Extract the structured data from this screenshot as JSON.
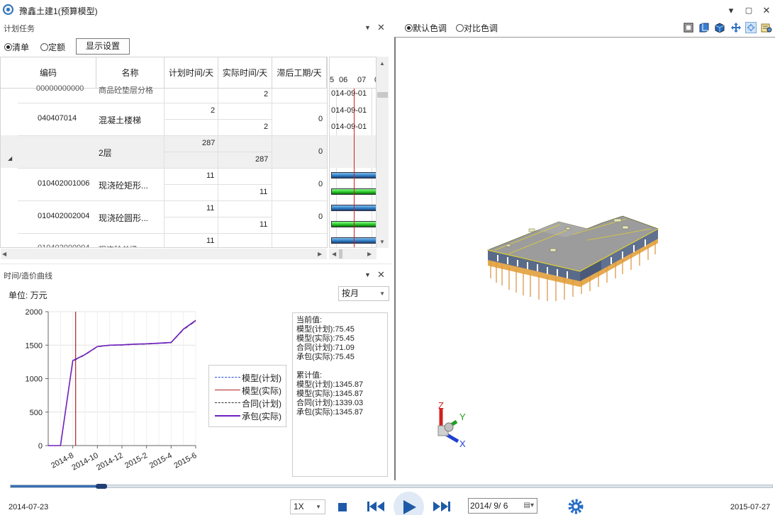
{
  "window": {
    "title": "豫鑫土建1(预算模型)",
    "minimize": "▾",
    "restore": "☐",
    "maximize": "☐",
    "close": "✕"
  },
  "task_panel": {
    "title": "计划任务",
    "mode_list": "清单",
    "mode_quota": "定额",
    "display_settings": "显示设置",
    "columns": [
      "编码",
      "名称",
      "计划时间/天",
      "实际时间/天",
      "滞后工期/天"
    ],
    "rows": [
      {
        "code": "",
        "name": "",
        "plan": "",
        "actual": "2",
        "lag": ""
      },
      {
        "code": "040407014",
        "name": "混凝土楼梯",
        "plan": "2",
        "actual": "2",
        "lag": "0"
      },
      {
        "code": "",
        "name": "2层",
        "plan": "287",
        "actual": "287",
        "lag": "0"
      },
      {
        "code": "010402001006",
        "name": "现浇砼矩形...",
        "plan": "11",
        "actual": "11",
        "lag": "0"
      },
      {
        "code": "010402002004",
        "name": "现浇砼圆形...",
        "plan": "11",
        "actual": "11",
        "lag": "0"
      },
      {
        "code": "",
        "name": "",
        "plan": "11",
        "actual": "",
        "lag": ""
      }
    ],
    "gantt_header": [
      "5",
      "06",
      "07",
      "0"
    ],
    "gantt_dates": [
      "014-09-01",
      "014-09-01",
      "014-09-01"
    ]
  },
  "curve_panel": {
    "title": "时间/造价曲线",
    "unit": "单位: 万元",
    "period": "按月",
    "current_title": "当前值:",
    "current": [
      "模型(计划):75.45",
      "模型(实际):75.45",
      "合同(计划):71.09",
      "承包(实际):75.45"
    ],
    "cumulative_title": "累计值:",
    "cumulative": [
      "模型(计划):1345.87",
      "模型(实际):1345.87",
      "合同(计划):1339.03",
      "承包(实际):1345.87"
    ]
  },
  "chart_data": {
    "type": "line",
    "x": [
      "2014-6",
      "2014-7",
      "2014-8",
      "2014-9",
      "2014-10",
      "2014-11",
      "2014-12",
      "2015-1",
      "2015-2",
      "2015-3",
      "2015-4",
      "2015-5",
      "2015-6"
    ],
    "x_tick_labels": [
      "2014-8",
      "2014-10",
      "2014-12",
      "2015-2",
      "2015-4",
      "2015-6"
    ],
    "ylim": [
      0,
      2000
    ],
    "y_ticks": [
      "2000",
      "1500",
      "1000",
      "500",
      "0"
    ],
    "current_marker": "2014-8",
    "series": [
      {
        "name": "模型(计划)",
        "color": "#2a4fd0",
        "style": "dashdot",
        "values": [
          0,
          0,
          1270,
          1360,
          1480,
          1500,
          1505,
          1515,
          1520,
          1530,
          1540,
          1740,
          1870
        ]
      },
      {
        "name": "模型(实际)",
        "color": "#b22222",
        "style": "solid",
        "values": [
          0,
          0,
          1270,
          1360,
          1480,
          1500,
          1505,
          1515,
          1520,
          1530,
          1540,
          1740,
          1870
        ]
      },
      {
        "name": "合同(计划)",
        "color": "#333333",
        "style": "dashdot",
        "values": [
          0,
          0,
          1260,
          1355,
          1475,
          1495,
          1500,
          1510,
          1515,
          1525,
          1535,
          1730,
          1860
        ]
      },
      {
        "name": "承包(实际)",
        "color": "#7020c0",
        "style": "solid",
        "values": [
          0,
          0,
          1270,
          1360,
          1480,
          1500,
          1505,
          1515,
          1520,
          1530,
          1540,
          1740,
          1870
        ]
      }
    ]
  },
  "view_panel": {
    "default_color": "默认色调",
    "contrast_color": "对比色调",
    "axis_x": "X",
    "axis_y": "Y",
    "axis_z": "Z"
  },
  "playback": {
    "start_date": "2014-07-23",
    "end_date": "2015-07-27",
    "speed": "1X",
    "date": "2014/ 9/ 6",
    "progress": 0.12
  }
}
